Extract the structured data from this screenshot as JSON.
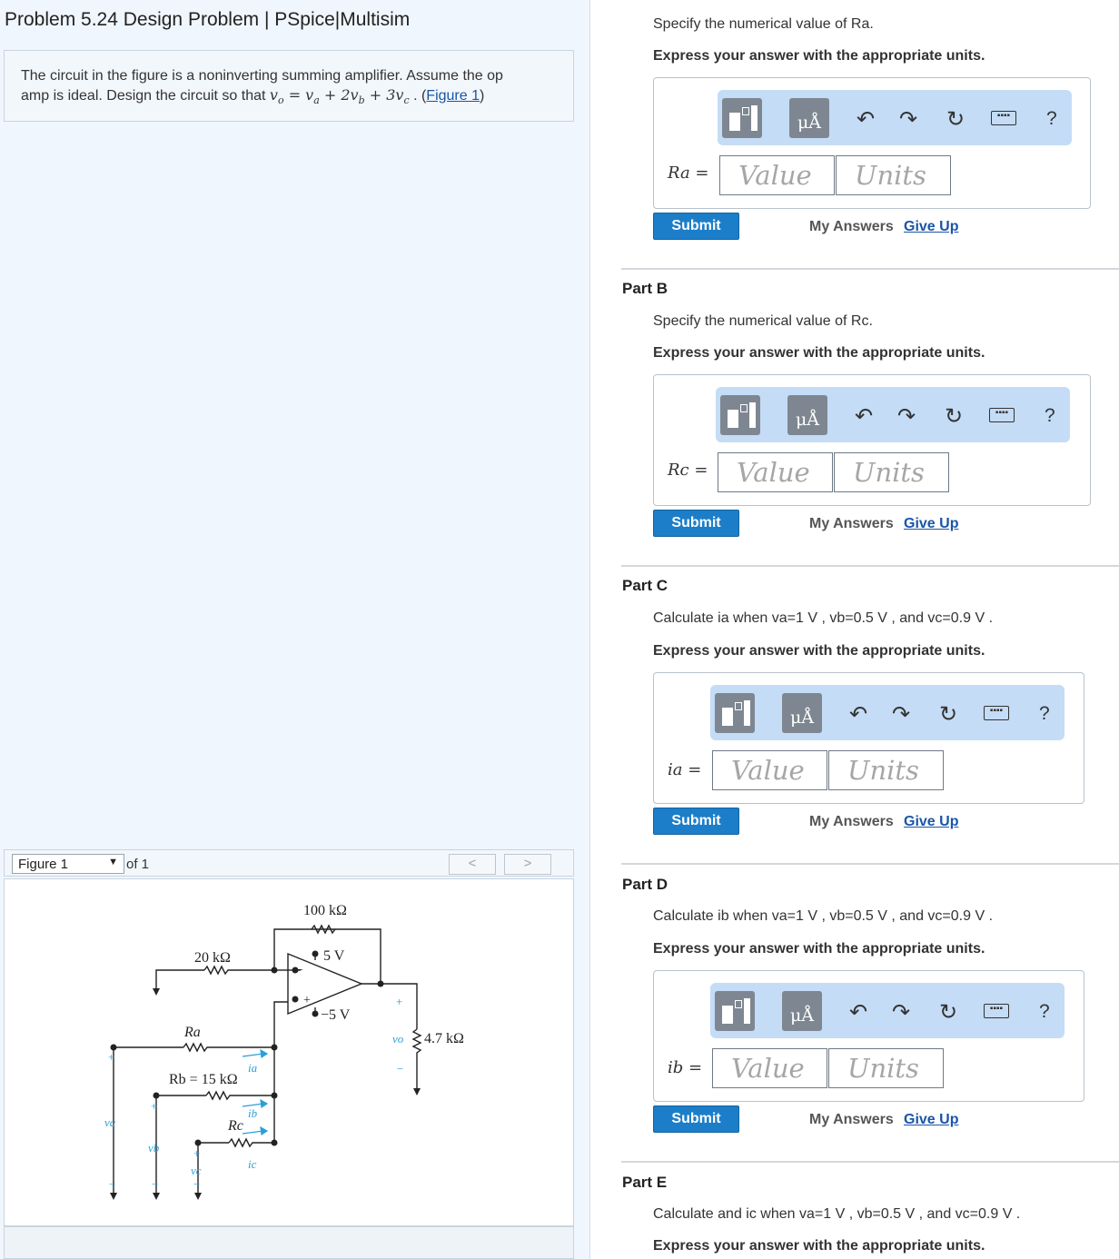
{
  "problem": {
    "title": "Problem 5.24 Design Problem | PSpice|Multisim",
    "text_line1": "The circuit in the figure is a noninverting summing amplifier. Assume the op",
    "text_line2_prefix": "amp is ideal. Design the circuit so that",
    "equation": "vo = va + 2vb + 3vc",
    "figure_link": "Figure 1"
  },
  "figure": {
    "select_value": "Figure 1",
    "of_label": "of 1",
    "prev_label": "<",
    "next_label": ">",
    "labels": {
      "r_100k": "100 kΩ",
      "r_20k": "20 kΩ",
      "plus5v": "5 V",
      "minus5v": "−5 V",
      "ra": "Ra",
      "rb": "Rb = 15 kΩ",
      "rc": "Rc",
      "r_load": "4.7 kΩ",
      "vo": "vo",
      "va": "va",
      "vb": "vb",
      "vc": "vc",
      "ia": "ia",
      "ib": "ib",
      "ic": "ic"
    }
  },
  "toolbar": {
    "templates_icon": "templates-icon",
    "units_label": "μÅ",
    "undo_icon": "undo-icon",
    "redo_icon": "redo-icon",
    "reset_icon": "reset-icon",
    "keyboard_icon": "keyboard-icon",
    "help_label": "?"
  },
  "common": {
    "express": "Express your answer with the appropriate units.",
    "value_placeholder": "Value",
    "units_placeholder": "Units",
    "submit": "Submit",
    "my_answers": "My Answers",
    "give_up": "Give Up"
  },
  "parts": {
    "a": {
      "prompt": "Specify the numerical value of Ra.",
      "label": "Ra ="
    },
    "b": {
      "title": "Part B",
      "prompt": "Specify the numerical value of Rc.",
      "label": "Rc ="
    },
    "c": {
      "title": "Part C",
      "prompt": "Calculate ia when va=1 V , vb=0.5 V , and vc=0.9 V .",
      "label": "ia ="
    },
    "d": {
      "title": "Part D",
      "prompt": "Calculate ib when va=1 V , vb=0.5 V , and vc=0.9 V .",
      "label": "ib ="
    },
    "e": {
      "title": "Part E",
      "prompt": "Calculate and ic when va=1 V , vb=0.5 V , and vc=0.9 V .",
      "express": "Express your answer with the appropriate units."
    }
  },
  "colors": {
    "submit_bg": "#1c7ec9",
    "toolbar_bg": "#c4dcf6",
    "link": "#1a55a7",
    "left_bg": "#f0f6fd"
  }
}
